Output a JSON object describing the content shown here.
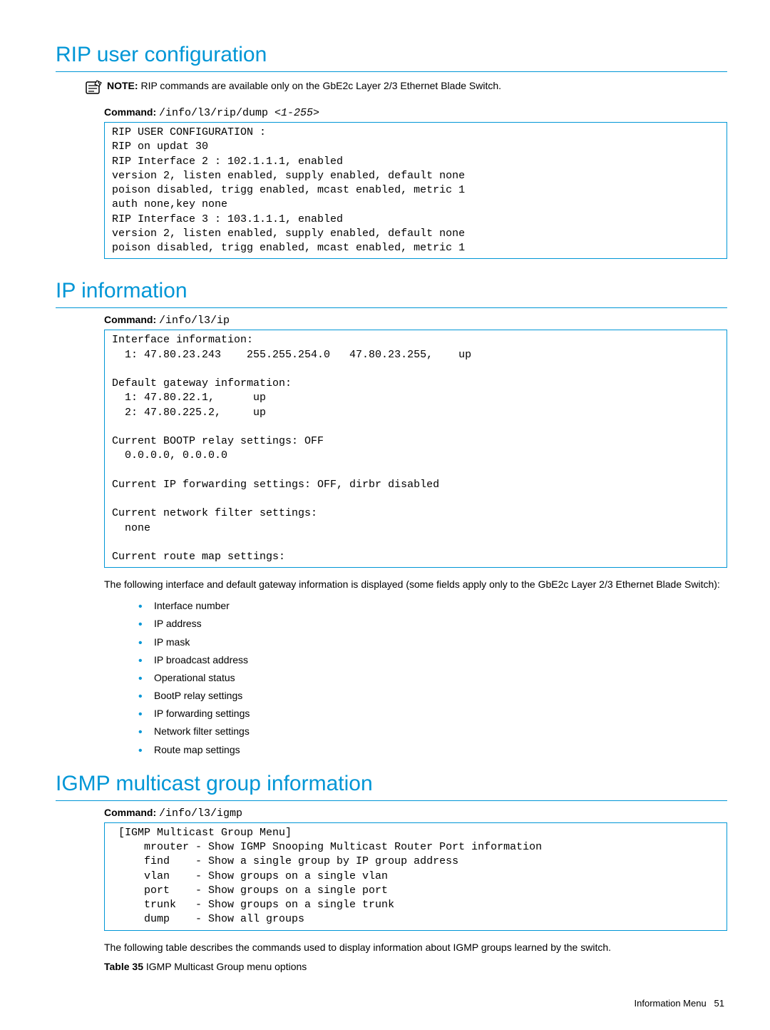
{
  "sections": {
    "rip": {
      "title": "RIP user configuration",
      "note_label": "NOTE:",
      "note_text": "RIP commands are available only on the GbE2c Layer 2/3 Ethernet Blade Switch.",
      "cmd_label": "Command:",
      "cmd_text": "/info/l3/rip/dump ",
      "cmd_arg": "<1-255>",
      "output": "RIP USER CONFIGURATION :\nRIP on updat 30\nRIP Interface 2 : 102.1.1.1, enabled\nversion 2, listen enabled, supply enabled, default none\npoison disabled, trigg enabled, mcast enabled, metric 1\nauth none,key none\nRIP Interface 3 : 103.1.1.1, enabled\nversion 2, listen enabled, supply enabled, default none\npoison disabled, trigg enabled, mcast enabled, metric 1"
    },
    "ip": {
      "title": "IP information",
      "cmd_label": "Command:",
      "cmd_text": "/info/l3/ip",
      "output": "Interface information:\n  1: 47.80.23.243    255.255.254.0   47.80.23.255,    up\n\nDefault gateway information:\n  1: 47.80.22.1,      up\n  2: 47.80.225.2,     up\n\nCurrent BOOTP relay settings: OFF\n  0.0.0.0, 0.0.0.0\n\nCurrent IP forwarding settings: OFF, dirbr disabled\n\nCurrent network filter settings:\n  none\n\nCurrent route map settings:",
      "body": "The following interface and default gateway information is displayed (some fields apply only to the GbE2c Layer 2/3 Ethernet Blade Switch):",
      "bullets": [
        "Interface number",
        "IP address",
        "IP mask",
        "IP broadcast address",
        "Operational status",
        "BootP relay settings",
        "IP forwarding settings",
        "Network filter settings",
        "Route map settings"
      ]
    },
    "igmp": {
      "title": "IGMP multicast group information",
      "cmd_label": "Command:",
      "cmd_text": "/info/l3/igmp",
      "output": " [IGMP Multicast Group Menu]\n     mrouter - Show IGMP Snooping Multicast Router Port information\n     find    - Show a single group by IP group address\n     vlan    - Show groups on a single vlan\n     port    - Show groups on a single port\n     trunk   - Show groups on a single trunk\n     dump    - Show all groups",
      "body": "The following table describes the commands used to display information about IGMP groups learned by the switch.",
      "table_caption_bold": "Table 35",
      "table_caption_text": "IGMP Multicast Group menu options"
    }
  },
  "footer": {
    "section": "Information Menu",
    "page": "51"
  }
}
